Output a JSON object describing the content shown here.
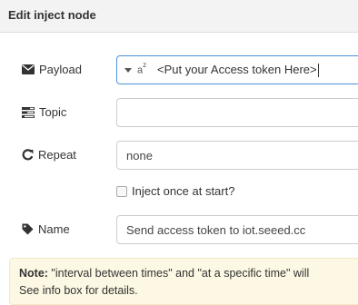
{
  "header": {
    "title": "Edit inject node"
  },
  "payload": {
    "label": "Payload",
    "icon": "envelope-icon",
    "type_icon": "string-type-icon",
    "type_glyph": "a",
    "type_sup": "z",
    "value": "<Put your Access token Here>"
  },
  "topic": {
    "label": "Topic",
    "icon": "tasks-icon",
    "value": ""
  },
  "repeat": {
    "label": "Repeat",
    "icon": "repeat-icon",
    "value": "none"
  },
  "once": {
    "label": "Inject once at start?",
    "checked": false
  },
  "name": {
    "label": "Name",
    "icon": "tag-icon",
    "value": "Send access token to iot.seeed.cc"
  },
  "note": {
    "title": "Note:",
    "line1": " \"interval between times\" and \"at a specific time\" will",
    "line2": "See info box for details."
  },
  "colors": {
    "focus_border": "#4a90d9",
    "note_bg": "#fcf8e3",
    "header_bg": "#f3f3f3"
  }
}
